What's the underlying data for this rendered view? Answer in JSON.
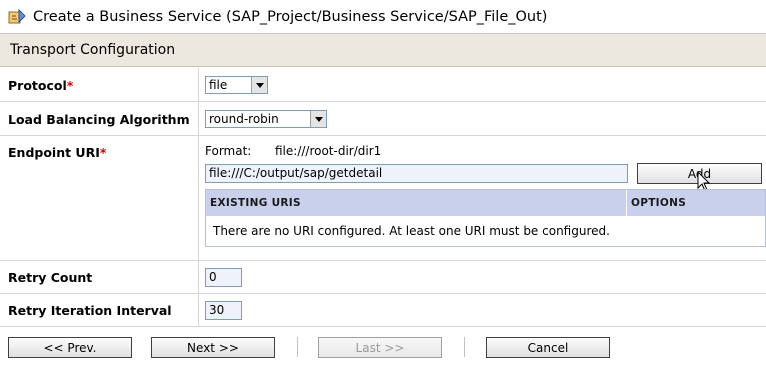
{
  "window": {
    "title": "Create a Business Service (SAP_Project/Business Service/SAP_File_Out)",
    "icon": "business-service-icon"
  },
  "section": {
    "title": "Transport Configuration"
  },
  "form": {
    "protocol": {
      "label": "Protocol",
      "required_mark": "*",
      "value": "file"
    },
    "load_balancing": {
      "label": "Load Balancing Algorithm",
      "value": "round-robin"
    },
    "endpoint_uri": {
      "label": "Endpoint URI",
      "required_mark": "*",
      "format_label": "Format:",
      "format_value": "file:///root-dir/dir1",
      "input_value": "file:///C:/output/sap/getdetail",
      "add_label": "Add",
      "table": {
        "col_existing": "EXISTING URIS",
        "col_options": "OPTIONS",
        "empty_message": "There are no URI configured. At least one URI must be configured."
      }
    },
    "retry_count": {
      "label": "Retry Count",
      "value": "0"
    },
    "retry_interval": {
      "label": "Retry Iteration Interval",
      "value": "30"
    }
  },
  "footer": {
    "prev_label": "<< Prev.",
    "next_label": "Next >>",
    "last_label": "Last >>",
    "cancel_label": "Cancel"
  },
  "colors": {
    "section_bg": "#ece8e0",
    "table_header_bg": "#c8d0eb",
    "required": "#d40000",
    "input_bg": "#eef3fb"
  }
}
